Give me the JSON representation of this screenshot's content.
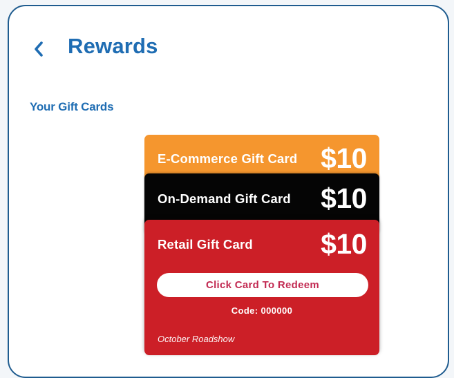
{
  "header": {
    "back_icon": "chevron-left-icon",
    "title": "Rewards"
  },
  "section": {
    "title": "Your Gift Cards"
  },
  "gift_cards": [
    {
      "name": "E-Commerce Gift Card",
      "amount": "$10",
      "color": "#f5962e"
    },
    {
      "name": "On-Demand Gift Card",
      "amount": "$10",
      "color": "#050505"
    },
    {
      "name": "Retail Gift Card",
      "amount": "$10",
      "color": "#cc1f27",
      "redeem_label": "Click Card To Redeem",
      "code_text": "Code: 000000",
      "event_name": "October Roadshow"
    }
  ],
  "colors": {
    "accent": "#1f6db3",
    "frame_border": "#1f5c8f",
    "redeem_text": "#c22a52"
  }
}
